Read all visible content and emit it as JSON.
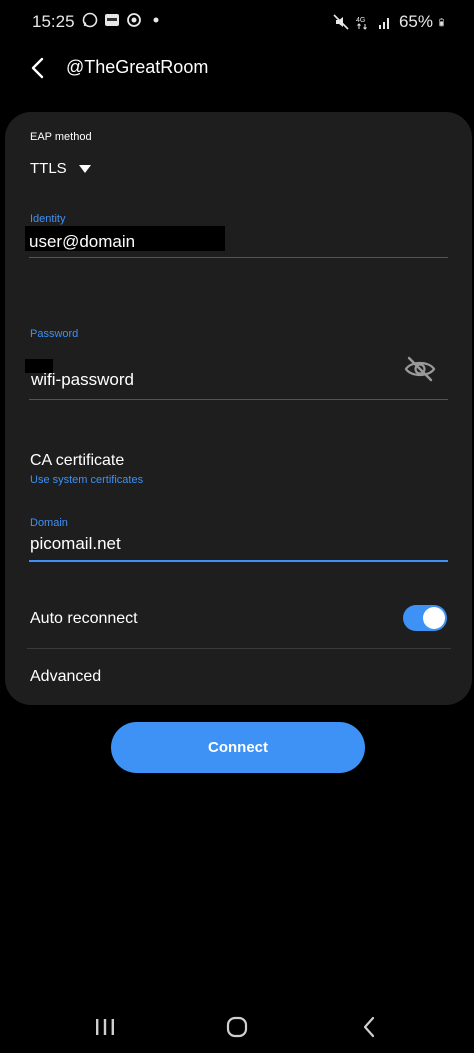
{
  "status_bar": {
    "time": "15:25",
    "battery": "65%"
  },
  "header": {
    "back_icon": "chevron-left-icon",
    "title": "@TheGreatRoom"
  },
  "form": {
    "eap_method": {
      "label": "EAP method",
      "value": "TTLS"
    },
    "identity": {
      "label": "Identity",
      "value": "user@domain"
    },
    "password": {
      "label": "Password",
      "value": "wifi-password",
      "visibility_icon": "eye-off-icon"
    },
    "ca_certificate": {
      "title": "CA certificate",
      "value": "Use system certificates"
    },
    "domain": {
      "label": "Domain",
      "value": "picomail.net"
    },
    "auto_reconnect": {
      "label": "Auto reconnect",
      "enabled": true
    },
    "advanced": {
      "label": "Advanced"
    }
  },
  "connect_button": {
    "label": "Connect"
  },
  "colors": {
    "accent": "#3e91f5",
    "card": "#1e1e1e",
    "background": "#000000"
  }
}
